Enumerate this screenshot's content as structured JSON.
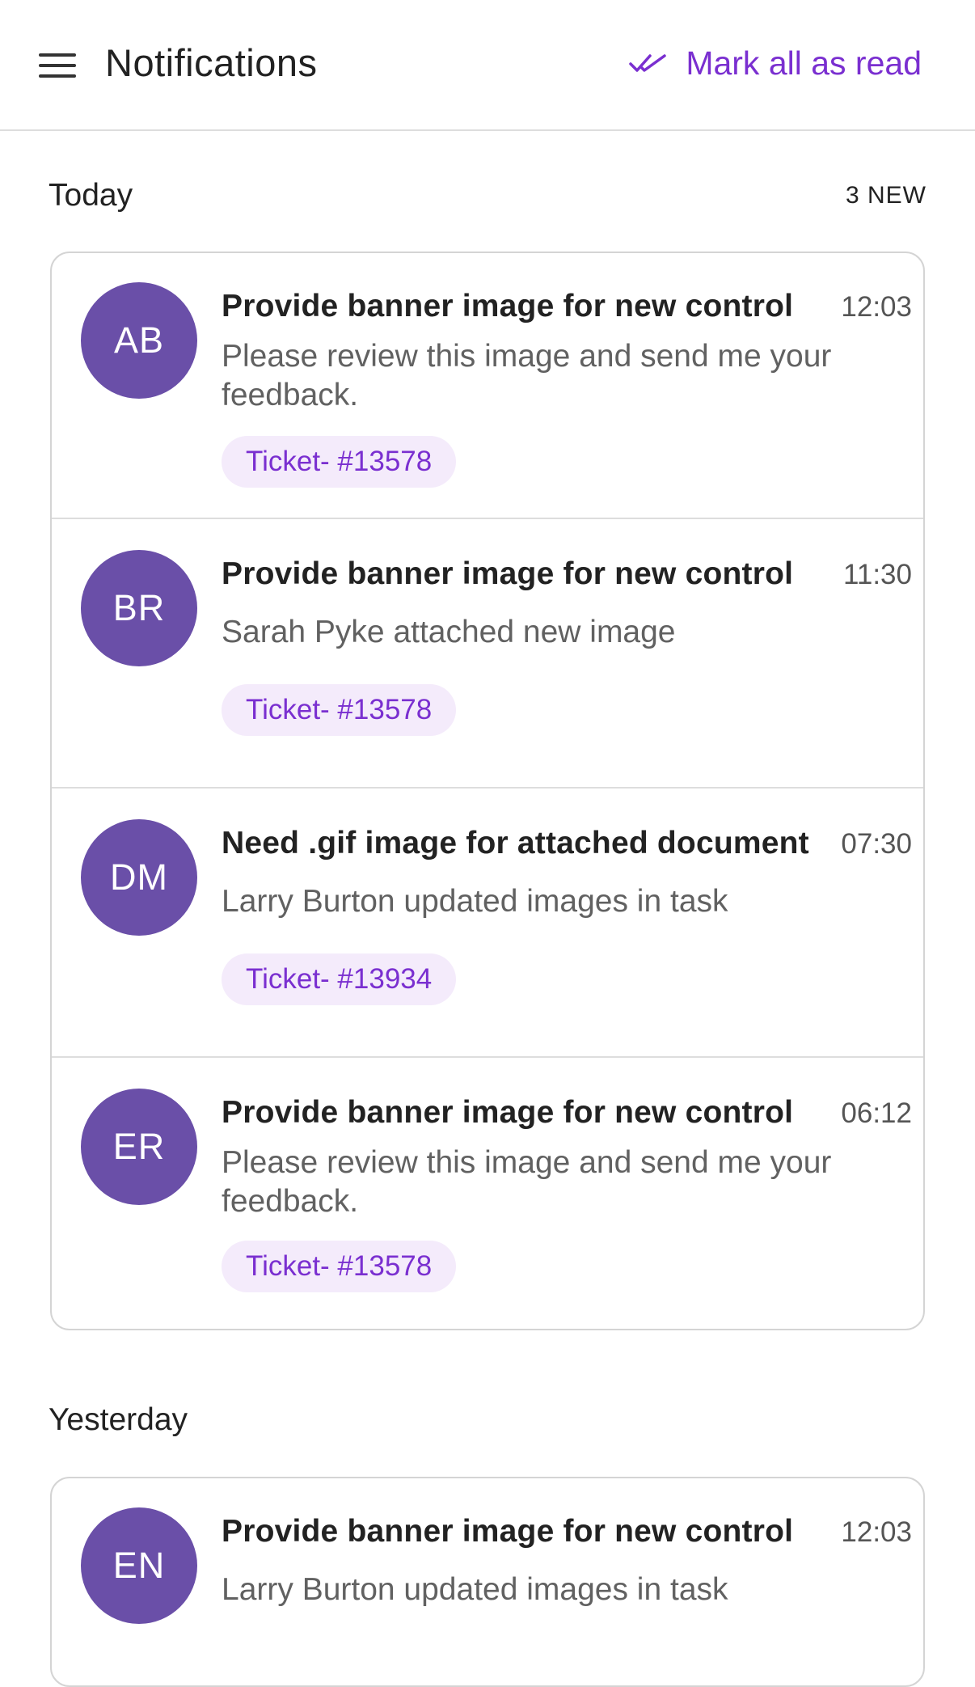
{
  "header": {
    "title": "Notifications",
    "mark_all_label": "Mark all as read"
  },
  "today": {
    "title": "Today",
    "new_count": "3 NEW",
    "items": [
      {
        "initials": "AB",
        "title": "Provide banner image for new control",
        "time": "12:03",
        "body": "Please review this image and send me your feedback.",
        "ticket": "Ticket- #13578"
      },
      {
        "initials": "BR",
        "title": "Provide banner image for new control",
        "time": "11:30",
        "body": "Sarah Pyke attached new image",
        "ticket": "Ticket- #13578"
      },
      {
        "initials": "DM",
        "title": "Need .gif image for attached document",
        "time": "07:30",
        "body": "Larry Burton updated images in task",
        "ticket": "Ticket- #13934"
      },
      {
        "initials": "ER",
        "title": "Provide banner image for new control",
        "time": "06:12",
        "body": "Please review this image and send me your feedback.",
        "ticket": "Ticket- #13578"
      }
    ]
  },
  "yesterday": {
    "title": "Yesterday",
    "items": [
      {
        "initials": "EN",
        "title": "Provide banner image for new control",
        "time": "12:03",
        "body": "Larry Burton updated images in task"
      }
    ]
  },
  "colors": {
    "accent": "#7a2fd0",
    "avatar": "#6a4fa8",
    "ticket_bg": "#f4ebfb"
  },
  "icons": {
    "menu": "menu-icon",
    "mark_all": "double-check-icon"
  }
}
